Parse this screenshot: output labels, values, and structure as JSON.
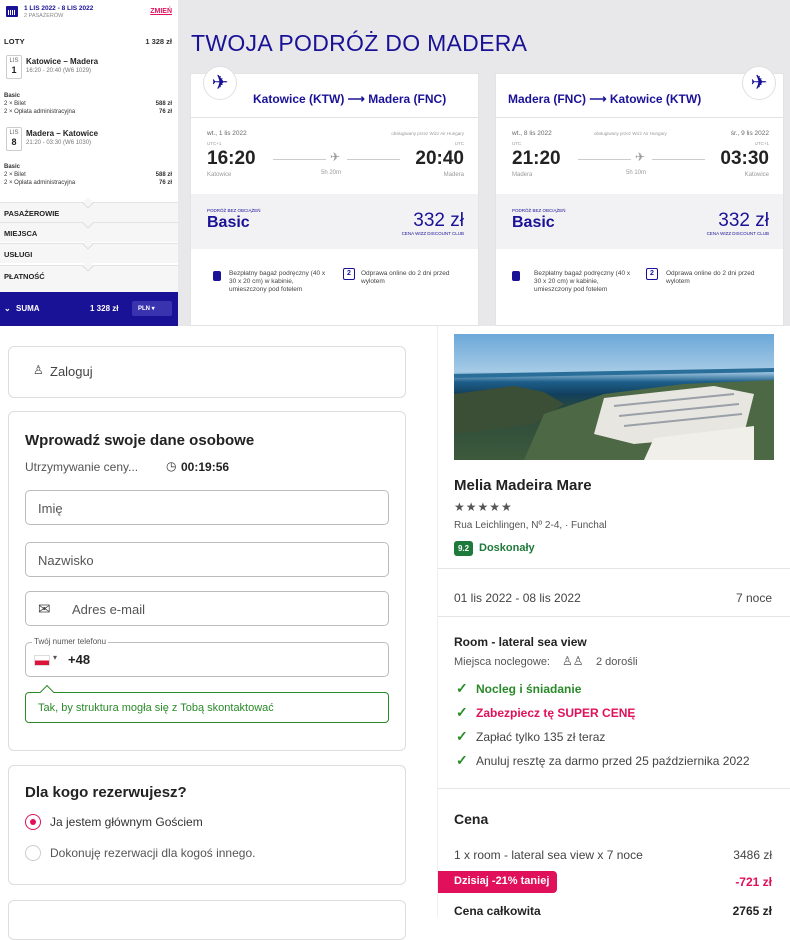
{
  "colors": {
    "wizz_blue": "#1a1296",
    "pink": "#e0105a",
    "green": "#2a8a2a"
  },
  "sidebar": {
    "dates": "1 LIS 2022 - 8 LIS 2022",
    "passengers": "2 PASAŻERÓW",
    "change": "ZMIEŃ",
    "flights_label": "LOTY",
    "flights_total": "1 328 zł",
    "flight1": {
      "month": "LIS",
      "day": "1",
      "title": "Katowice – Madera",
      "sub": "16:20 - 20:40 (W6 1029)"
    },
    "flight1_lines": [
      {
        "l": "Basic",
        "r": ""
      },
      {
        "l": "2 × Bilet",
        "r": "588 zł"
      },
      {
        "l": "2 × Opłata administracyjna",
        "r": "76 zł"
      }
    ],
    "flight2": {
      "month": "LIS",
      "day": "8",
      "title": "Madera – Katowice",
      "sub": "21:20 - 03:30 (W6 1030)"
    },
    "flight2_lines": [
      {
        "l": "Basic",
        "r": ""
      },
      {
        "l": "2 × Bilet",
        "r": "588 zł"
      },
      {
        "l": "2 × Opłata administracyjna",
        "r": "76 zł"
      }
    ],
    "sections": [
      "PASAŻEROWIE",
      "MIEJSCA",
      "USŁUGI",
      "PŁATNOŚĆ"
    ],
    "sum_label": "SUMA",
    "sum_value": "1 328 zł",
    "currency": "PLN"
  },
  "title": "TWOJA PODRÓŻ DO MADERA",
  "outbound": {
    "route": "Katowice (KTW) ⟶ Madera (FNC)",
    "dep_date": "wt., 1 lis 2022",
    "operated": "obsługiwany przez Wizz Air Hungary",
    "dep_tz": "UTC+1",
    "arr_tz": "UTC",
    "dep_time": "16:20",
    "arr_time": "20:40",
    "duration": "5h 20m",
    "dep_city": "Katowice",
    "arr_city": "Madera",
    "fare_label": "PODRÓŻ BEZ OBCIĄŻEŃ",
    "fare_name": "Basic",
    "price": "332 zł",
    "club": "CENA WIZZ DISCOUNT CLUB",
    "perk1": "Bezpłatny bagaż podręczny (40 x 30 x 20 cm) w kabinie, umieszczony pod fotelem",
    "perk2": "Odprawa online do 2 dni przed wylotem",
    "checkin_num": "2"
  },
  "inbound": {
    "route": "Madera (FNC) ⟶ Katowice (KTW)",
    "dep_date": "wt., 8 lis 2022",
    "operated": "obsługiwany przez Wizz Air Hungary",
    "arr_date": "śr., 9 lis 2022",
    "dep_tz": "UTC",
    "arr_tz": "UTC+1",
    "dep_time": "21:20",
    "arr_time": "03:30",
    "duration": "5h 10m",
    "dep_city": "Madera",
    "arr_city": "Katowice",
    "fare_label": "PODRÓŻ BEZ OBCIĄŻEŃ",
    "fare_name": "Basic",
    "price": "332 zł",
    "club": "CENA WIZZ DISCOUNT CLUB",
    "perk1": "Bezpłatny bagaż podręczny (40 x 30 x 20 cm) w kabinie, umieszczony pod fotelem",
    "perk2": "Odprawa online do 2 dni przed wylotem",
    "checkin_num": "2"
  },
  "login": "Zaloguj",
  "personal": {
    "title": "Wprowadź swoje dane osobowe",
    "hold_text": "Utrzymywanie ceny...",
    "timer": "00:19:56",
    "first_name": "Imię",
    "last_name": "Nazwisko",
    "email": "Adres e-mail",
    "phone_label": "Twój numer telefonu",
    "phone_code": "+48",
    "tooltip": "Tak, by struktura mogła się z Tobą skontaktować"
  },
  "booking_for": {
    "title": "Dla kogo rezerwujesz?",
    "opt1": "Ja jestem głównym Gościem",
    "opt2": "Dokonuję rezerwacji dla kogoś innego."
  },
  "hotel": {
    "name": "Melia Madeira Mare",
    "stars": "★★★★★",
    "address": "Rua Leichlingen, Nº 2-4, · Funchal",
    "score": "9.2",
    "score_text": "Doskonały",
    "dates": "01 lis 2022 - 08 lis 2022",
    "nights": "7 noce",
    "room": "Room - lateral sea view",
    "beds_label": "Miejsca noclegowe:",
    "beds_value": "2 dorośli",
    "perks": [
      "Nocleg i śniadanie",
      "Zabezpiecz tę SUPER CENĘ",
      "Zapłać tylko 135 zł teraz",
      "Anuluj resztę za darmo przed 25 października 2022"
    ],
    "price_title": "Cena",
    "line1_label": "1 x room - lateral sea view x 7 noce",
    "line1_value": "3486 zł",
    "discount_label": "Dzisiaj -21% taniej",
    "discount_value": "-721 zł",
    "total_label": "Cena całkowita",
    "total_value": "2765 zł"
  }
}
